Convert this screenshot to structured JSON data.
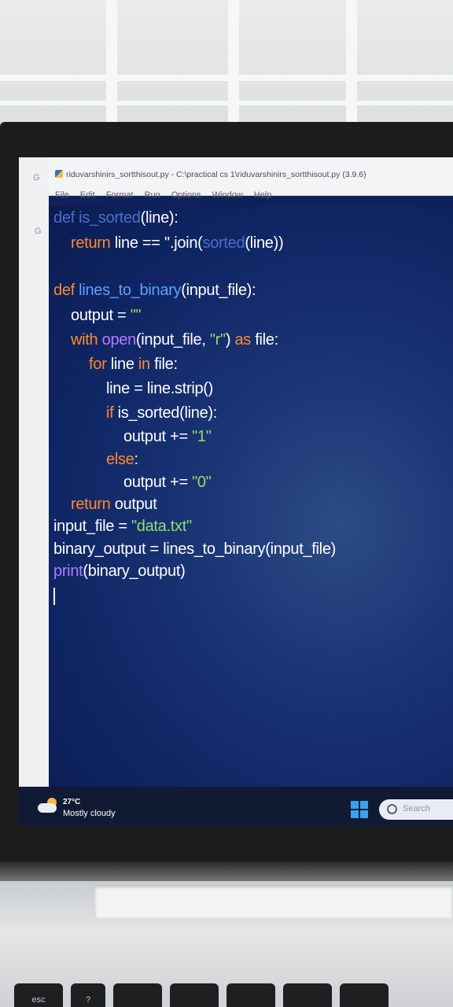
{
  "window": {
    "title": "riduvarshinirs_sortthisout.py - C:\\practical cs 1\\riduvarshinirs_sortthisout.py (3.9.6)"
  },
  "menu": [
    "File",
    "Edit",
    "Format",
    "Run",
    "Options",
    "Window",
    "Help"
  ],
  "left_panel": {
    "letters": [
      "G",
      "G"
    ]
  },
  "code": {
    "l1_def": "def ",
    "l1_name": "is_sorted",
    "l1_rest": "(line):",
    "l2_kw": "return",
    "l2_a": " line == ''.join(",
    "l2_bi": "sorted",
    "l2_b": "(line))",
    "l3_def": "def ",
    "l3_name": "lines_to_binary",
    "l3_rest": "(input_file):",
    "l4_a": "output = ",
    "l4_str": "\"\"",
    "l5_kw": "with ",
    "l5_bi": "open",
    "l5_a": "(input_file, ",
    "l5_str": "\"r\"",
    "l5_b": ") ",
    "l5_kw2": "as",
    "l5_c": " file:",
    "l6_kw": "for",
    "l6_a": " line ",
    "l6_kw2": "in",
    "l6_b": " file:",
    "l7": "line = line.strip()",
    "l8_kw": "if",
    "l8_a": " is_sorted(line):",
    "l9_a": "output += ",
    "l9_str": "\"1\"",
    "l10_kw": "else",
    "l10_a": ":",
    "l11_a": "output += ",
    "l11_str": "\"0\"",
    "l12_kw": "return",
    "l12_a": " output",
    "l13_a": "input_file = ",
    "l13_str": "\"data.txt\"",
    "l14": "binary_output = lines_to_binary(input_file)",
    "l15_bi": "print",
    "l15_a": "(binary_output)"
  },
  "taskbar": {
    "temperature": "27°C",
    "condition": "Mostly cloudy",
    "search_placeholder": "Search"
  },
  "keyboard": {
    "esc_label": "esc",
    "key2_label": "?"
  },
  "colors": {
    "editor_bg": "#0f2564",
    "keyword": "#ff8a2a",
    "builtin": "#b47cff",
    "function_name": "#5ea0ff",
    "string": "#8ee06a"
  }
}
